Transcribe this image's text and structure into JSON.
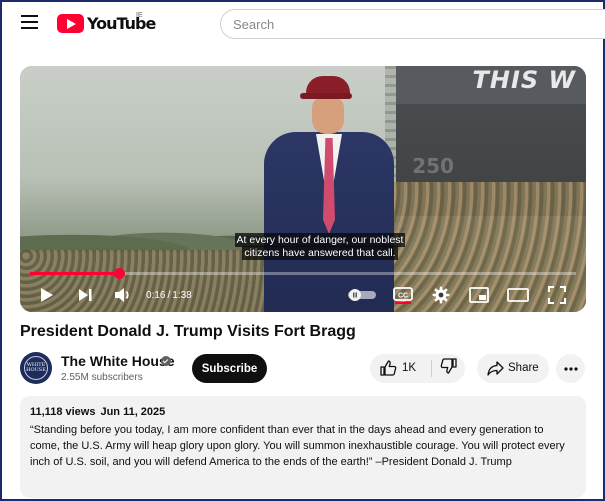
{
  "header": {
    "logo_text": "YouTube",
    "country_code": "IE",
    "search_placeholder": "Search"
  },
  "player": {
    "stage_banner": "THIS W",
    "stage_number": "250",
    "caption_line1": "At every hour of danger, our noblest",
    "caption_line2": "citizens have answered that call.",
    "current_time": "0:16",
    "time_separator": "/",
    "duration": "1:38",
    "progress_fraction": 0.163,
    "accent_color": "#ff0033"
  },
  "video": {
    "title": "President Donald J. Trump Visits Fort Bragg"
  },
  "channel": {
    "name": "The White House",
    "subscribers": "2.55M subscribers",
    "avatar_text": "WHITE HOUSE",
    "subscribe_label": "Subscribe"
  },
  "actions": {
    "like_count": "1K",
    "share_label": "Share",
    "icons": [
      "thumbs-up-icon",
      "thumbs-down-icon",
      "share-icon",
      "more-icon"
    ]
  },
  "description": {
    "views": "11,118 views",
    "date": "Jun 11, 2025",
    "text": "“Standing before you today, I am more confident than ever that in the days ahead and every generation to come, the U.S. Army will heap glory upon glory. You will summon inexhaustible courage. You will protect every inch of U.S. soil, and you will defend America to the ends of the earth!” –President Donald J. Trump"
  }
}
